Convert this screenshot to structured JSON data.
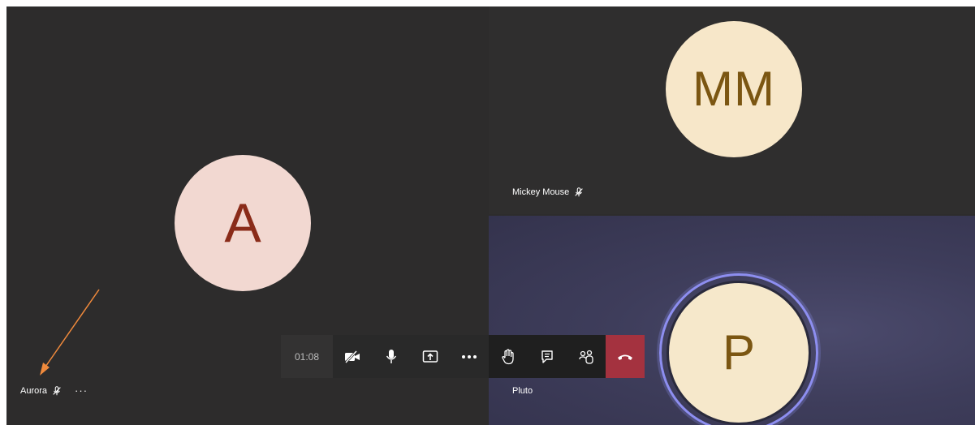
{
  "participants": {
    "aurora": {
      "name": "Aurora",
      "initials": "A",
      "more_label": "···"
    },
    "mickey": {
      "name": "Mickey Mouse",
      "initials": "MM"
    },
    "pluto": {
      "name": "Pluto",
      "initials": "P"
    }
  },
  "toolbar": {
    "timer": "01:08",
    "buttons": [
      "camera-off",
      "microphone",
      "share-screen",
      "more-actions",
      "raise-hand",
      "chat",
      "participants",
      "hang-up"
    ]
  },
  "colors": {
    "stage_bg": "#2d2c2c",
    "aurora_avatar_bg": "#f2d8d1",
    "aurora_avatar_text": "#8a2b19",
    "mickey_avatar_bg": "#f7e7c9",
    "pluto_avatar_bg": "#f6e8cb",
    "speaking_ring": "#8d8ef0",
    "hangup_bg": "#a4323f",
    "annotation_arrow": "#f08a3c"
  }
}
